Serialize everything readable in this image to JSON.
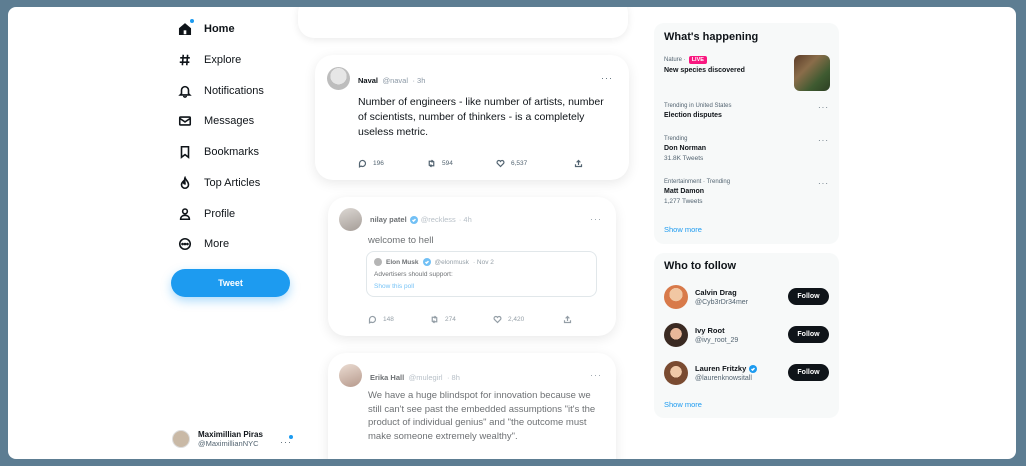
{
  "sidebar": {
    "items": [
      {
        "label": "Home",
        "icon": "home-icon"
      },
      {
        "label": "Explore",
        "icon": "hashtag-icon"
      },
      {
        "label": "Notifications",
        "icon": "bell-icon"
      },
      {
        "label": "Messages",
        "icon": "mail-icon"
      },
      {
        "label": "Bookmarks",
        "icon": "bookmark-icon"
      },
      {
        "label": "Top Articles",
        "icon": "flame-icon"
      },
      {
        "label": "Profile",
        "icon": "person-icon"
      },
      {
        "label": "More",
        "icon": "more-circle-icon"
      }
    ],
    "tweet_button": "Tweet",
    "account": {
      "name": "Maximillian Piras",
      "handle": "@MaximillianNYC",
      "more": "···"
    }
  },
  "timeline": {
    "tweets": [
      {
        "name": "Naval",
        "handle": "@naval",
        "time": "· 3h",
        "text": "Number of engineers - like number of artists, number of scientists, number of thinkers - is a completely useless metric.",
        "replies": "196",
        "retweets": "594",
        "likes": "6,537",
        "more": "···"
      },
      {
        "name": "nilay patel",
        "handle": "@reckless",
        "time": "· 4h",
        "text": "welcome to hell",
        "quote": {
          "name": "Elon Musk",
          "handle": "@elonmusk",
          "time": "· Nov 2",
          "text": "Advertisers should support:",
          "link": "Show this poll"
        },
        "replies": "148",
        "retweets": "274",
        "likes": "2,420",
        "more": "···"
      },
      {
        "name": "Erika Hall",
        "handle": "@mulegirl",
        "time": "· 8h",
        "text": "We have a huge blindspot for innovation because we still can't see past the embedded assumptions \"it's the product of individual genius\" and \"the outcome must make someone extremely wealthy\".",
        "more": "···"
      }
    ]
  },
  "happening": {
    "title": "What's happening",
    "trends": [
      {
        "context": "Nature ·",
        "badge": "LIVE",
        "title": "New species discovered"
      },
      {
        "context": "Trending in United States",
        "title": "Election disputes",
        "more": "···"
      },
      {
        "context": "Trending",
        "title": "Don Norman",
        "count": "31.8K Tweets",
        "more": "···"
      },
      {
        "context": "Entertainment · Trending",
        "title": "Matt Damon",
        "count": "1,277 Tweets",
        "more": "···"
      }
    ],
    "show_more": "Show more"
  },
  "who_to_follow": {
    "title": "Who to follow",
    "users": [
      {
        "name": "Calvin Drag",
        "handle": "@Cyb3rDr34mer",
        "button": "Follow"
      },
      {
        "name": "Ivy Root",
        "handle": "@ivy_root_29",
        "button": "Follow"
      },
      {
        "name": "Lauren Fritzky",
        "handle": "@laurenknowsitall",
        "button": "Follow",
        "verified": true
      }
    ],
    "show_more": "Show more"
  },
  "colors": {
    "accent": "#1d9bf0",
    "live": "#f91880",
    "frame": "#5d7d92"
  }
}
